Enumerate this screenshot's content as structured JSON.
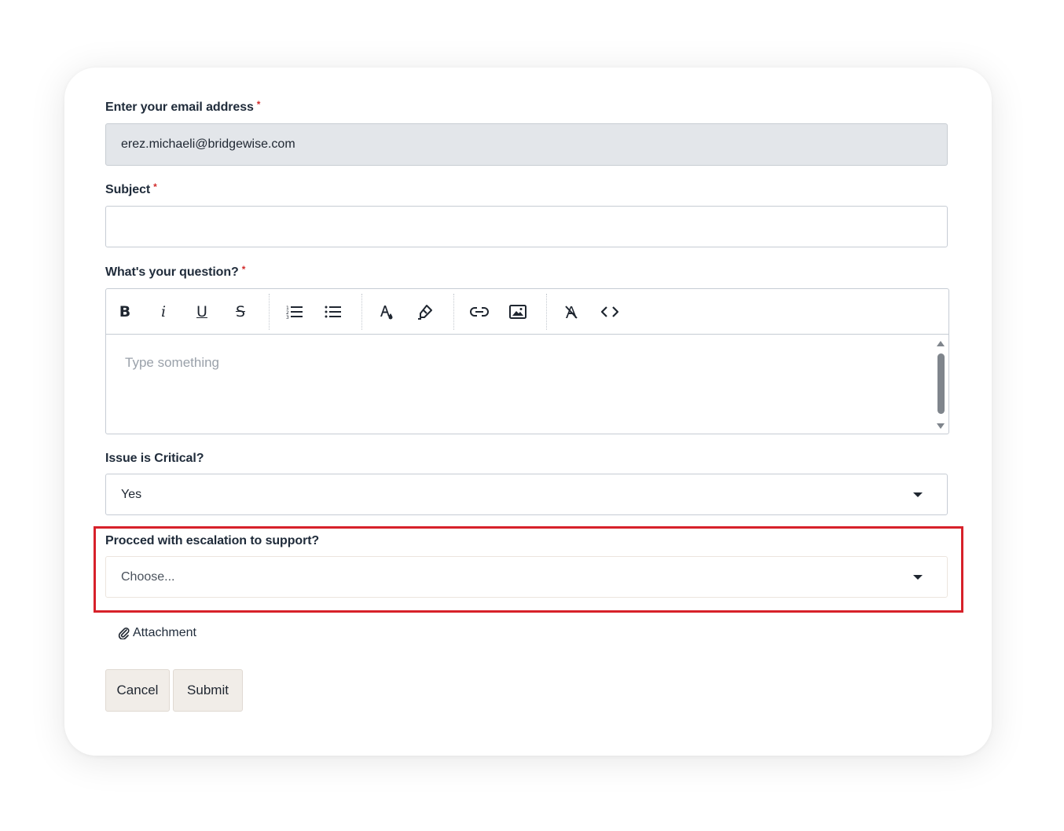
{
  "form": {
    "email": {
      "label": "Enter your email address",
      "required_mark": "*",
      "value": "erez.michaeli@bridgewise.com"
    },
    "subject": {
      "label": "Subject",
      "required_mark": "*",
      "value": ""
    },
    "question": {
      "label": "What's your question?",
      "required_mark": "*",
      "placeholder": "Type something",
      "toolbar": {
        "bold": "B",
        "italic": "i",
        "underline": "U",
        "strikethrough": "S"
      }
    },
    "critical": {
      "label": "Issue is Critical?",
      "selected": "Yes"
    },
    "escalation": {
      "label": "Procced with escalation to support?",
      "selected": "Choose..."
    },
    "attachment_label": "Attachment",
    "cancel_label": "Cancel",
    "submit_label": "Submit"
  },
  "colors": {
    "highlight": "#d7212a",
    "required": "#d12b2b"
  }
}
